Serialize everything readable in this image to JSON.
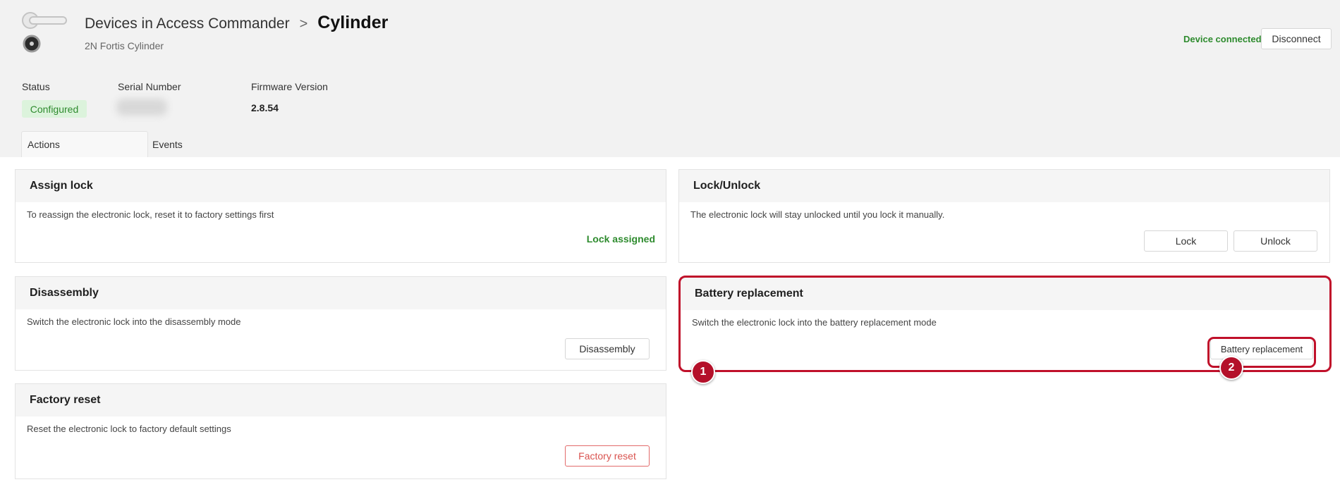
{
  "header": {
    "breadcrumb_root": "Devices in Access Commander",
    "breadcrumb_separator": ">",
    "breadcrumb_current": "Cylinder",
    "subtitle": "2N Fortis Cylinder",
    "connection_status": "Device connected",
    "disconnect_label": "Disconnect",
    "device_icon": "door-handle-cylinder-icon"
  },
  "info": {
    "status_label": "Status",
    "status_value": "Configured",
    "serial_label": "Serial Number",
    "firmware_label": "Firmware Version",
    "firmware_value": "2.8.54"
  },
  "tabs": [
    {
      "label": "Actions",
      "active": true
    },
    {
      "label": "Events",
      "active": false
    }
  ],
  "cards": {
    "assign": {
      "title": "Assign lock",
      "description": "To reassign the electronic lock, reset it to factory settings first",
      "status": "Lock assigned"
    },
    "lock_unlock": {
      "title": "Lock/Unlock",
      "description": "The electronic lock will stay unlocked until you lock it manually.",
      "lock_label": "Lock",
      "unlock_label": "Unlock"
    },
    "disassembly": {
      "title": "Disassembly",
      "description": "Switch the electronic lock into the disassembly mode",
      "button_label": "Disassembly"
    },
    "battery": {
      "title": "Battery replacement",
      "description": "Switch the electronic lock into the battery replacement mode",
      "button_label": "Battery replacement"
    },
    "factory": {
      "title": "Factory reset",
      "description": "Reset the electronic lock to factory default settings",
      "button_label": "Factory reset"
    }
  },
  "callouts": {
    "one": "1",
    "two": "2"
  },
  "colors": {
    "success": "#2e8b2e",
    "danger": "#d9534f",
    "highlight": "#c0102a"
  }
}
